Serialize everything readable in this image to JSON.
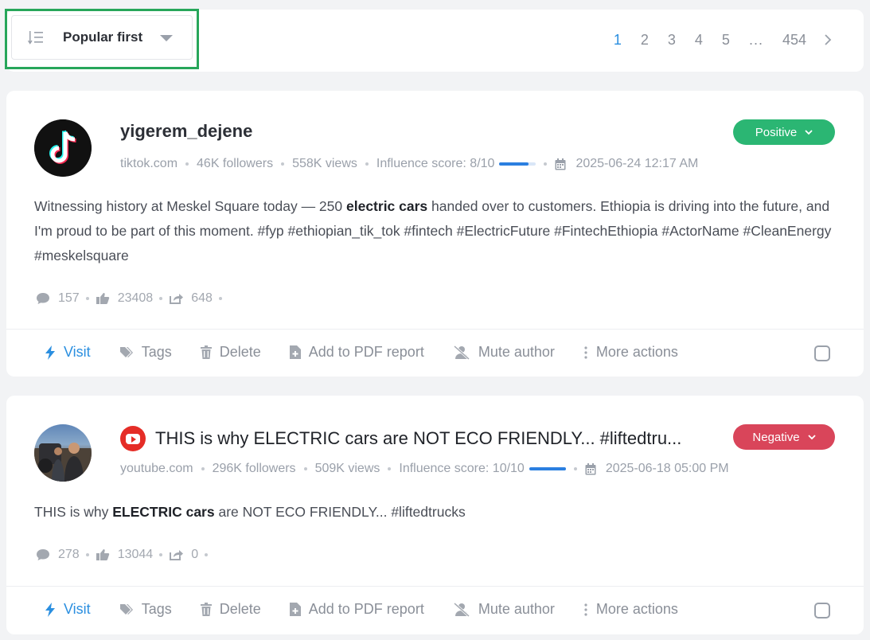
{
  "toolbar": {
    "sort_label": "Popular first",
    "pages": [
      "1",
      "2",
      "3",
      "4",
      "5",
      "...",
      "454"
    ]
  },
  "posts": [
    {
      "author": "yigerem_dejene",
      "platform_icon": "tiktok-logo",
      "source": "tiktok.com",
      "followers": "46K followers",
      "views": "558K views",
      "influence_label": "Influence score: 8/10",
      "influence_value": 0.8,
      "datetime": "2025-06-24 12:17 AM",
      "sentiment": "Positive",
      "sentiment_color": "#2bb673",
      "text_parts": [
        "Witnessing history at Meskel Square today — 250 ",
        "electric cars",
        " handed over to customers. Ethiopia is driving into the future, and I'm proud to be part of this moment. #fyp #ethiopian_tik_tok #fintech #ElectricFuture #FintechEthiopia #ActorName #CleanEnergy #meskelsquare"
      ],
      "comments": "157",
      "likes": "23408",
      "shares": "648"
    },
    {
      "author": "THIS is why ELECTRIC cars are NOT ECO FRIENDLY... #liftedtru...",
      "platform_icon": "youtube-logo",
      "source": "youtube.com",
      "followers": "296K followers",
      "views": "509K views",
      "influence_label": "Influence score: 10/10",
      "influence_value": 1.0,
      "datetime": "2025-06-18 05:00 PM",
      "sentiment": "Negative",
      "sentiment_color": "#d9455a",
      "text_parts": [
        "THIS is why ",
        "ELECTRIC cars",
        " are NOT ECO FRIENDLY... #liftedtrucks"
      ],
      "comments": "278",
      "likes": "13044",
      "shares": "0"
    }
  ],
  "actions": {
    "visit": "Visit",
    "tags": "Tags",
    "delete": "Delete",
    "pdf": "Add to PDF report",
    "mute": "Mute author",
    "more": "More actions"
  }
}
